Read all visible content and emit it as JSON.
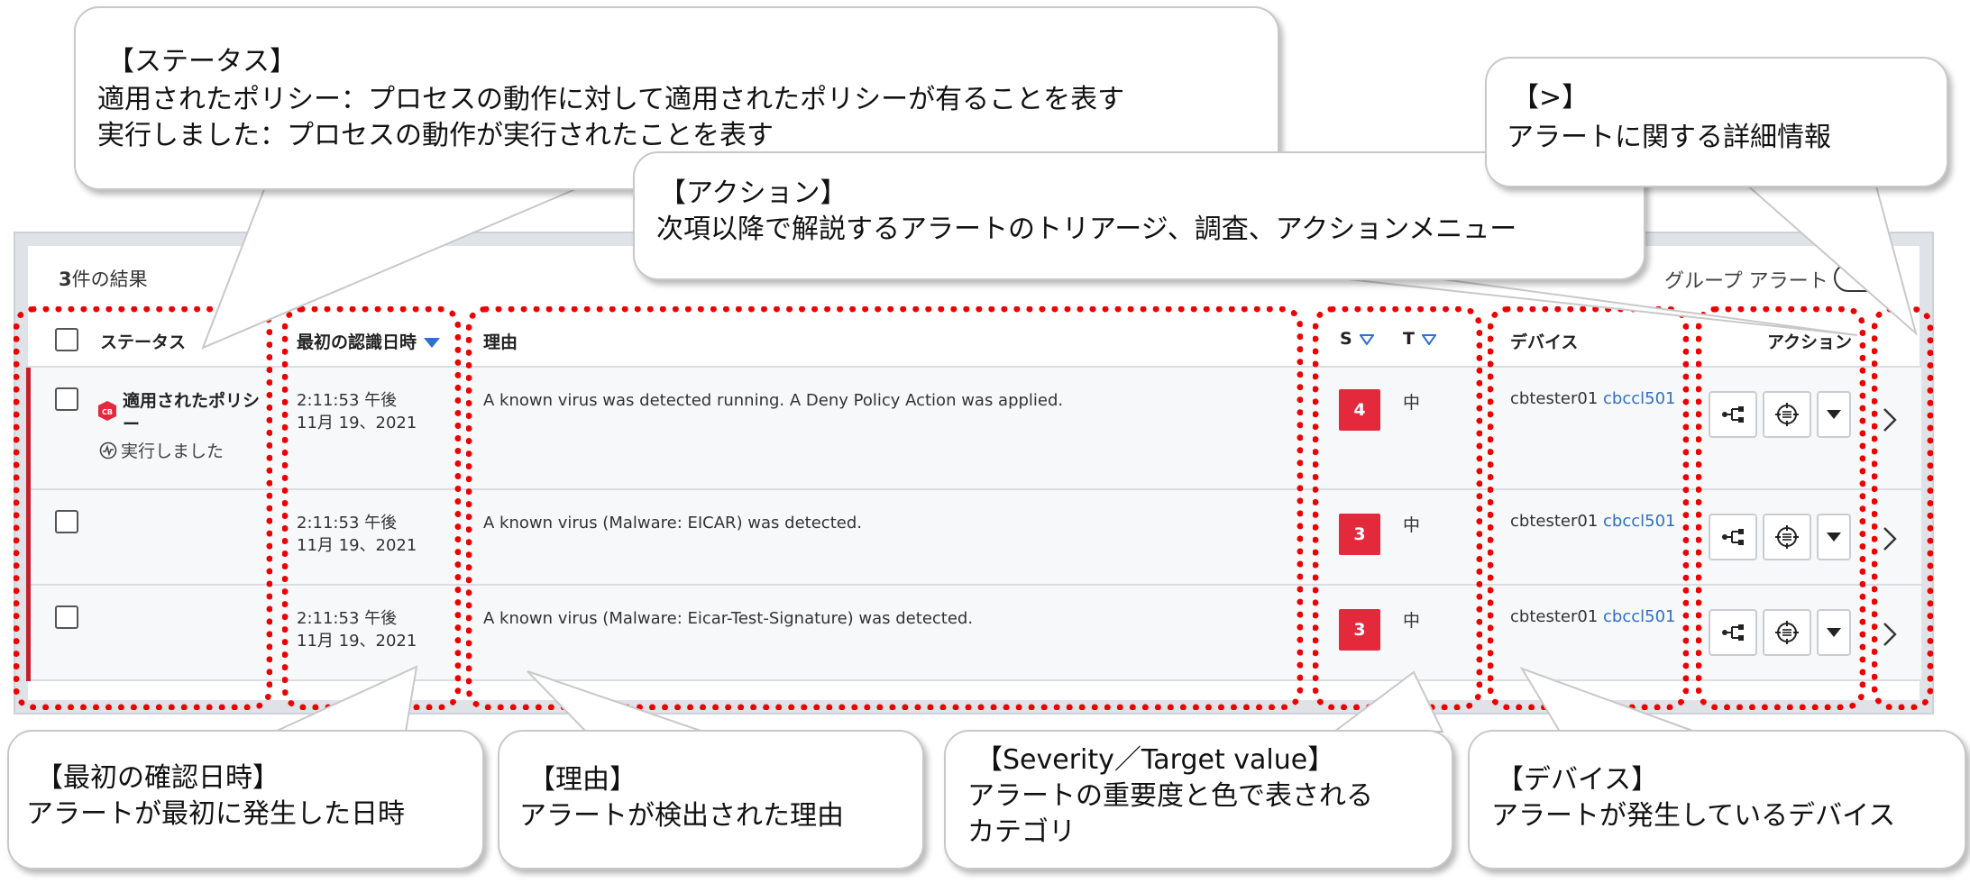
{
  "toolbar": {
    "results_count": "3",
    "results_label": "件の結果",
    "group_alerts_label": "グループ アラート"
  },
  "table": {
    "columns": {
      "status": "ステータス",
      "first_seen": "最初の認識日時",
      "reason": "理由",
      "severity": "S",
      "target": "T",
      "device": "デバイス",
      "actions": "アクション"
    },
    "rows": [
      {
        "status_line1": "適用されたポリシ",
        "status_line1b": "ー",
        "status_line2": "実行しました",
        "time": "2:11:53 午後",
        "date": "11月 19、2021",
        "reason": "A known virus was detected running. A Deny Policy Action was applied.",
        "severity": "4",
        "target": "中",
        "device_name": "cbtester01",
        "device_group": "cbccl501"
      },
      {
        "status_line1": "",
        "status_line1b": "",
        "status_line2": "",
        "time": "2:11:53 午後",
        "date": "11月 19、2021",
        "reason": "A known virus (Malware: EICAR) was detected.",
        "severity": "3",
        "target": "中",
        "device_name": "cbtester01",
        "device_group": "cbccl501"
      },
      {
        "status_line1": "",
        "status_line1b": "",
        "status_line2": "",
        "time": "2:11:53 午後",
        "date": "11月 19、2021",
        "reason": "A known virus (Malware: Eicar-Test-Signature) was detected.",
        "severity": "3",
        "target": "中",
        "device_name": "cbtester01",
        "device_group": "cbccl501"
      }
    ]
  },
  "callouts": {
    "status": {
      "title": "【ステータス】",
      "line1": "適用されたポリシー：プロセスの動作に対して適用されたポリシーが有ることを表す",
      "line2": "実行しました：プロセスの動作が実行されたことを表す"
    },
    "action": {
      "title": "【アクション】",
      "line1": "次項以降で解説するアラートのトリアージ、調査、アクションメニュー"
    },
    "detail": {
      "title": "【>】",
      "line1": "アラートに関する詳細情報"
    },
    "first_seen": {
      "title": "【最初の確認日時】",
      "line1": "アラートが最初に発生した日時"
    },
    "reason": {
      "title": "【理由】",
      "line1": "アラートが検出された理由"
    },
    "severity": {
      "title": "【Severity／Target value】",
      "line1": "アラートの重要度と色で表される",
      "line2": "カテゴリ"
    },
    "device": {
      "title": "【デバイス】",
      "line1": "アラートが発生しているデバイス"
    }
  },
  "colors": {
    "severity_badge": "#e3293b",
    "row_accent": "#c81e2c",
    "highlight_dots": "#ef0000",
    "link": "#2f6fc4",
    "sort_arrow": "#2c6fd6"
  },
  "icons": {
    "row_actions": [
      "process-tree-icon",
      "investigate-target-icon",
      "dropdown-caret-icon"
    ],
    "status": [
      "policy-shield-icon",
      "ran-activity-icon"
    ],
    "detail": "chevron-right-icon"
  }
}
